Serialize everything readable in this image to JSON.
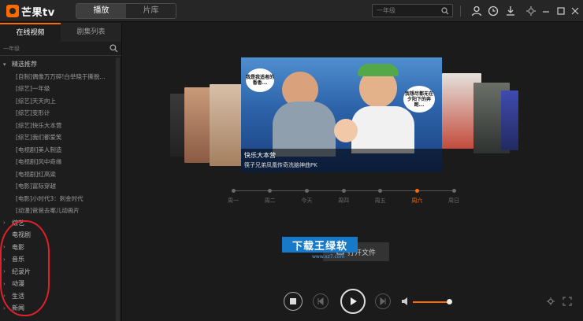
{
  "app": {
    "name": "芒果tv"
  },
  "mode_tabs": [
    {
      "label": "播放",
      "active": true
    },
    {
      "label": "片库",
      "active": false
    }
  ],
  "top_search": {
    "placeholder": "一年级"
  },
  "toolbar_icons": [
    "user-icon",
    "history-icon",
    "download-icon",
    "settings-icon",
    "minimize-icon",
    "maximize-icon",
    "close-icon"
  ],
  "sidebar": {
    "tabs": [
      {
        "label": "在线视频",
        "active": true
      },
      {
        "label": "剧集列表",
        "active": false
      }
    ],
    "search_placeholder": "一年级",
    "featured_group": {
      "label": "精选推荐",
      "items": [
        "[自制]偶像万万碎!白举晓于撕脱...",
        "[综艺]一年级",
        "[综艺]天天向上",
        "[综艺]变形计",
        "[综艺]快乐大本营",
        "[综艺]我们都爱笑",
        "[电视剧]美人制造",
        "[电视剧]风中奇缘",
        "[电视剧]红高粱",
        "[电影]富际穿越",
        "[电影]小时代3：刺金时代",
        "[动漫]爸爸去哪儿动画片"
      ]
    },
    "categories": [
      "综艺",
      "电视剧",
      "电影",
      "音乐",
      "纪录片",
      "动漫",
      "生活",
      "新闻"
    ]
  },
  "featured": {
    "title": "快乐大本营",
    "subtitle": "筷子兄弟凤凰传奇洗脑神曲PK",
    "bubble_left": "我是我适者的香香...",
    "bubble_right": "我想尽都无在夕阳下的奔跑..."
  },
  "timeline": {
    "days": [
      "周一",
      "周二",
      "今天",
      "周四",
      "周五",
      "周六",
      "周日"
    ],
    "active_index": 5
  },
  "open_file_label": "打开文件",
  "watermark": {
    "text": "下载王绿软",
    "sub": "www.xz7.com"
  },
  "colors": {
    "accent": "#ff6a00",
    "annotation": "#e0202a"
  }
}
